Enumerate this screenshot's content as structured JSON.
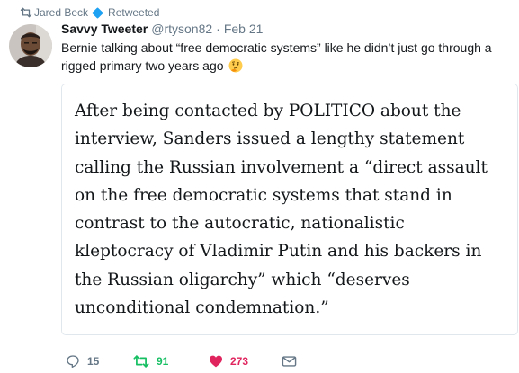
{
  "retweet_context": {
    "user_name": "Jared Beck",
    "label": "Retweeted",
    "icon": "retweet-icon",
    "verified_icon": "verified-badge-icon"
  },
  "tweet": {
    "author": {
      "full_name": "Savvy Tweeter",
      "username": "@rtyson82",
      "avatar_icon": "avatar-photo"
    },
    "separator": "·",
    "timestamp": "Feb 21",
    "text": "Bernie talking about “free democratic systems” like he didn’t just go through a rigged primary two years ago",
    "emoji": "thinking-face-emoji",
    "quote": {
      "text": "After being contacted by POLITICO about the interview, Sanders issued a lengthy statement calling the Russian involvement a “direct assault on the free democratic systems that stand in contrast to the autocratic, nationalistic kleptocracy of Vladimir Putin and his backers in the Russian oligarchy” which “deserves unconditional condemnation.”"
    },
    "actions": {
      "reply_count": "15",
      "retweet_count": "91",
      "like_count": "273",
      "colors": {
        "neutral": "#657786",
        "retweet": "#17bf63",
        "like": "#e0245e",
        "verified": "#1da1f2"
      }
    }
  }
}
